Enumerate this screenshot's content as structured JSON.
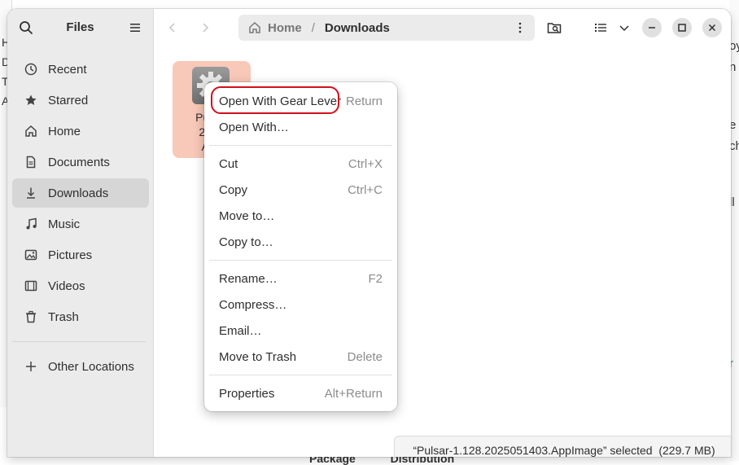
{
  "sidebar": {
    "title": "Files",
    "items": [
      {
        "label": "Recent",
        "icon": "clock-icon"
      },
      {
        "label": "Starred",
        "icon": "star-icon"
      },
      {
        "label": "Home",
        "icon": "home-icon"
      },
      {
        "label": "Documents",
        "icon": "document-icon"
      },
      {
        "label": "Downloads",
        "icon": "download-icon"
      },
      {
        "label": "Music",
        "icon": "music-icon"
      },
      {
        "label": "Pictures",
        "icon": "picture-icon"
      },
      {
        "label": "Videos",
        "icon": "video-icon"
      },
      {
        "label": "Trash",
        "icon": "trash-icon"
      }
    ],
    "other_locations": "Other Locations",
    "active_item": "Downloads"
  },
  "path": {
    "home": "Home",
    "separator": "/",
    "current": "Downloads"
  },
  "file": {
    "line1": "Pulsar",
    "line2": "2025",
    "line3": "App"
  },
  "context_menu": {
    "group1": [
      {
        "label": "Open With Gear Lever",
        "accel": "Return"
      },
      {
        "label": "Open With…",
        "accel": ""
      }
    ],
    "group2": [
      {
        "label": "Cut",
        "accel": "Ctrl+X"
      },
      {
        "label": "Copy",
        "accel": "Ctrl+C"
      },
      {
        "label": "Move to…",
        "accel": ""
      },
      {
        "label": "Copy to…",
        "accel": ""
      }
    ],
    "group3": [
      {
        "label": "Rename…",
        "accel": "F2"
      },
      {
        "label": "Compress…",
        "accel": ""
      },
      {
        "label": "Email…",
        "accel": ""
      },
      {
        "label": "Move to Trash",
        "accel": "Delete"
      }
    ],
    "group4": [
      {
        "label": "Properties",
        "accel": "Alt+Return"
      }
    ]
  },
  "status": "“Pulsar-1.128.2025051403.AppImage” selected  (229.7 MB)",
  "background": {
    "left_letters": [
      "H",
      "D",
      "T",
      "A"
    ],
    "right_letters": [
      "oy",
      "n",
      "e",
      "ch",
      "ll",
      "r"
    ],
    "bottom_text": "Package           Distribution"
  },
  "colors": {
    "highlight_ring": "#d0101a",
    "selection_fill": "#f8c8b8"
  }
}
